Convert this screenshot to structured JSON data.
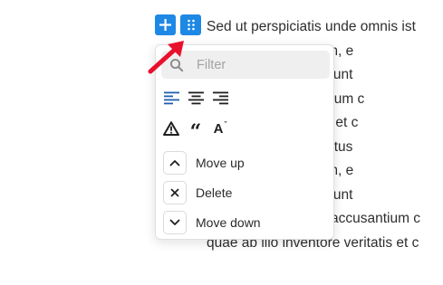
{
  "paragraph": {
    "lines": [
      "Sed ut perspiciatis unde omnis ist",
      "rem aperiam, e",
      "vitae dicta sunt",
      "m accusantium c",
      "ore veritatis et c",
      "mnis iste natus",
      "rem aperiam, e",
      "vitae dicta sunt",
      "error sit voluptatem accusantium c",
      "quae ab illo inventore veritatis et c"
    ]
  },
  "toolbar": {
    "add_icon": "plus-icon",
    "drag_icon": "drag-handle-icon",
    "accent_color": "#1e88e5"
  },
  "annotation": {
    "arrow_color": "#e8112d"
  },
  "popup": {
    "filter": {
      "placeholder": "Filter",
      "value": ""
    },
    "alignment_tools": [
      "align-left-icon",
      "align-center-icon",
      "align-right-icon"
    ],
    "format_tools": [
      "warning-icon",
      "quote-icon",
      "font-size-icon"
    ],
    "items": [
      {
        "label": "Move up",
        "icon": "chevron-up-icon"
      },
      {
        "label": "Delete",
        "icon": "close-icon"
      },
      {
        "label": "Move down",
        "icon": "chevron-down-icon"
      }
    ]
  }
}
